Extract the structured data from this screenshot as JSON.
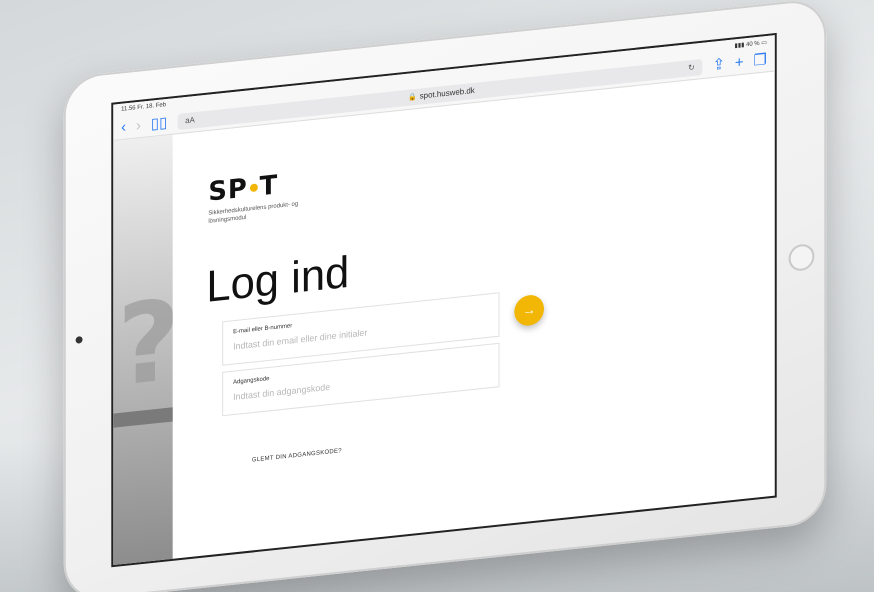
{
  "status_bar": {
    "time": "11.56",
    "date": "Fr. 18. Feb",
    "battery": "40 %"
  },
  "browser": {
    "back_icon": "chevron-left-icon",
    "forward_icon": "chevron-right-icon",
    "bookmarks_icon": "book-icon",
    "text_size_label": "aA",
    "url": "spot.husweb.dk",
    "reload_icon": "reload-icon",
    "share_icon": "share-icon",
    "new_tab_icon": "plus-icon",
    "tabs_icon": "tabs-icon"
  },
  "brand": {
    "logo_left": "SP",
    "logo_right": "T",
    "tagline": "Sikkerhedskulturelens produkt- og lösningsmodul",
    "accent_color": "#f2b705"
  },
  "login": {
    "heading": "Log ind",
    "email_label": "E-mail eller B-nummer",
    "email_placeholder": "Indtast din email eller dine initialer",
    "password_label": "Adgangskode",
    "password_placeholder": "Indtast din adgangskode",
    "submit_icon": "arrow-right-icon",
    "submit_symbol": "→",
    "forgot_link": "GLEMT DIN ADGANGSKODE?"
  }
}
